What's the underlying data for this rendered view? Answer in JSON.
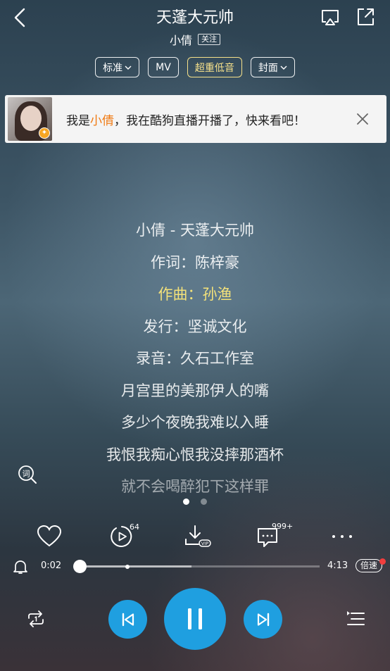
{
  "header": {
    "song_title": "天蓬大元帅",
    "singer": "小倩",
    "follow_label": "关注"
  },
  "tags": [
    {
      "label": "标准",
      "dropdown": true
    },
    {
      "label": "MV",
      "dropdown": false
    },
    {
      "label": "超重低音",
      "dropdown": false,
      "highlight": true
    },
    {
      "label": "封面",
      "dropdown": true
    }
  ],
  "banner": {
    "text_before": "我是",
    "name": "小倩",
    "text_after": "，我在酷狗直播开播了，快来看吧！"
  },
  "lyrics": {
    "lines": [
      "小倩 - 天蓬大元帅",
      "作词：陈梓豪",
      "作曲：孙渔",
      "发行：坚诚文化",
      "录音：久石工作室",
      "月宫里的美那伊人的嘴",
      "多少个夜晚我难以入睡",
      "我恨我痴心恨我没摔那酒杯",
      "就不会喝醉犯下这样罪"
    ],
    "active_index": 2
  },
  "pager": {
    "count": 2,
    "active": 0
  },
  "actions": {
    "play_count": "64",
    "comment_count": "999+"
  },
  "playback": {
    "current_time": "0:02",
    "total_time": "4:13",
    "progress": 0.008,
    "buffered": 0.47,
    "speed_label": "倍速"
  },
  "colors": {
    "accent": "#1f9fe0",
    "highlight_lyric": "#f4e27a",
    "banner_name": "#f07a12"
  }
}
